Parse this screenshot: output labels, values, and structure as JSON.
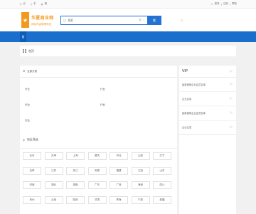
{
  "topbar": {
    "left_items": [
      {
        "icon": "location-pin-icon",
        "label": "北"
      },
      {
        "icon": "phone-icon",
        "label": "手"
      },
      {
        "icon": "wechat-icon",
        "label": "微"
      }
    ],
    "right_items": [
      "登录",
      "注册",
      "帮助"
    ]
  },
  "logo": {
    "line1": "华夏商业网",
    "line2": "网站内容管理系统"
  },
  "search": {
    "placeholder": "搜索",
    "select": "全",
    "button": "搜"
  },
  "nav": {
    "home": "首"
  },
  "breadcrumb": {
    "label": "首页"
  },
  "categories": {
    "title": "全部分类",
    "items": [
      "行业",
      "行业",
      "行业",
      "行业",
      "行业"
    ]
  },
  "region": {
    "title": "地区筛选",
    "rows": [
      [
        "北京",
        "天津",
        "上海",
        "重庆",
        "河北",
        "山西",
        "辽宁"
      ],
      [
        "吉林",
        "江苏",
        "浙江",
        "安徽",
        "福建",
        "江西",
        "山东"
      ],
      [
        "河南",
        "湖北",
        "湖南",
        "广东",
        "广西",
        "海南",
        "四川"
      ],
      [
        "贵州",
        "云南",
        "陕西",
        "甘肃",
        "青海",
        "宁夏",
        "新疆"
      ]
    ]
  },
  "vip": {
    "title": "VIP",
    "items": [
      "最新推荐企业会员名单",
      "企业名录",
      "最新推荐企业会员名单",
      "企业名录"
    ]
  }
}
